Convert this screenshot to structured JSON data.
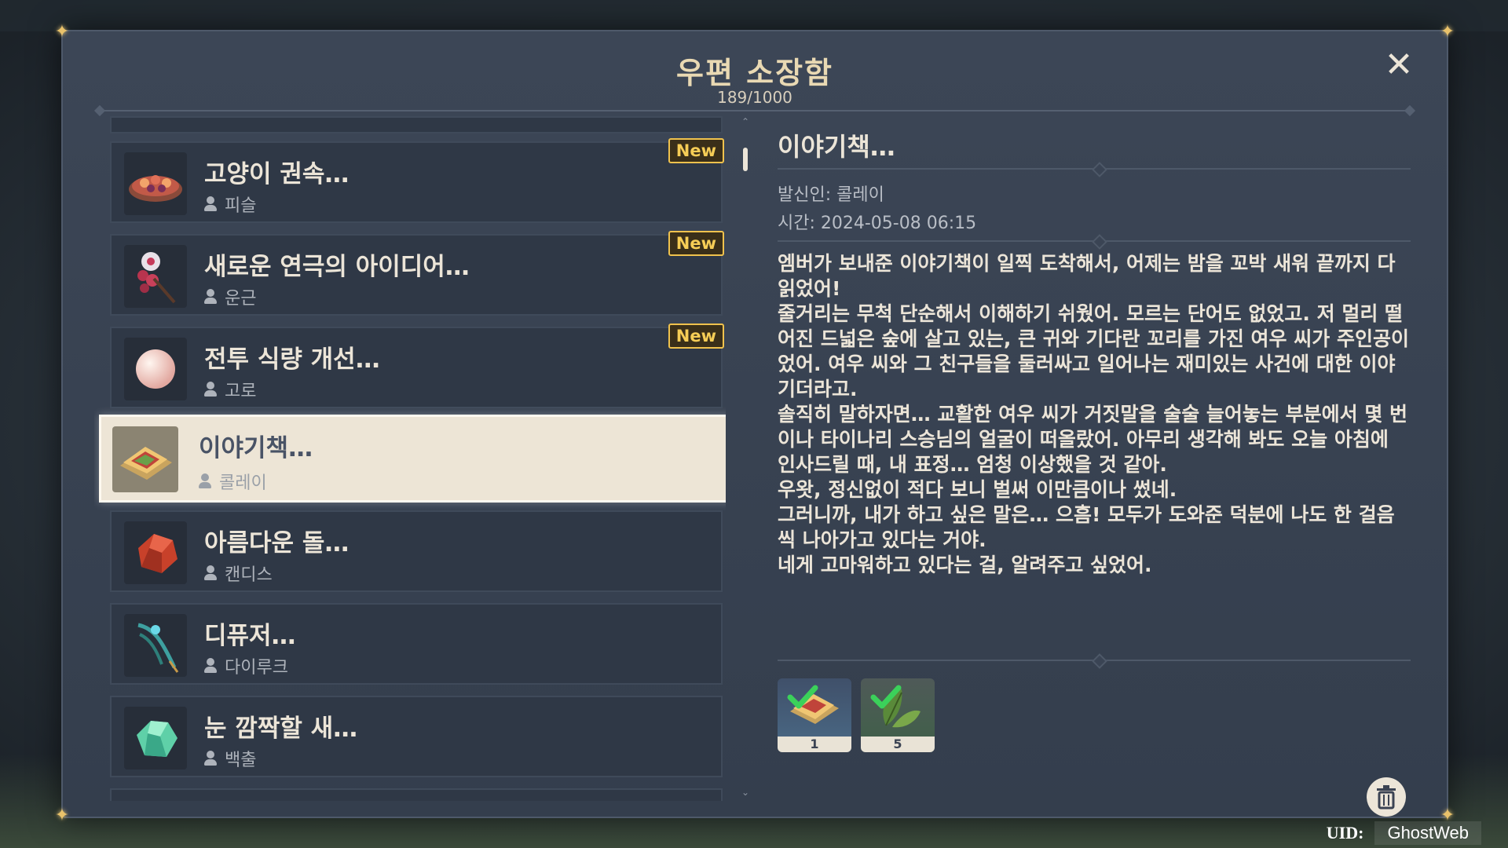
{
  "window": {
    "title": "우편 소장함",
    "count": "189/1000"
  },
  "mail_list": [
    {
      "title": "고양이 권속…",
      "sender": "피슬",
      "is_new": true,
      "new_label": "New",
      "icon": "meat-dish-icon"
    },
    {
      "title": "새로운 연극의 아이디어…",
      "sender": "운근",
      "is_new": true,
      "new_label": "New",
      "icon": "flower-pin-icon"
    },
    {
      "title": "전투 식량 개선…",
      "sender": "고로",
      "is_new": true,
      "new_label": "New",
      "icon": "pearl-icon"
    },
    {
      "title": "이야기책…",
      "sender": "콜레이",
      "is_new": false,
      "selected": true,
      "icon": "sandwich-icon"
    },
    {
      "title": "아름다운 돌…",
      "sender": "캔디스",
      "is_new": false,
      "icon": "red-crystal-icon"
    },
    {
      "title": "디퓨저…",
      "sender": "다이루크",
      "is_new": false,
      "icon": "feather-icon"
    },
    {
      "title": "눈 깜짝할 새…",
      "sender": "백출",
      "is_new": false,
      "icon": "green-crystal-icon"
    }
  ],
  "detail": {
    "title": "이야기책…",
    "sender": "발신인: 콜레이",
    "time": "시간: 2024-05-08 06:15",
    "body": [
      "엠버가 보내준 이야기책이 일찍 도착해서, 어제는 밤을 꼬박 새워 끝까지 다 읽었어!",
      "줄거리는 무척 단순해서 이해하기 쉬웠어. 모르는 단어도 없었고. 저 멀리 떨어진 드넓은 숲에 살고 있는, 큰 귀와 기다란 꼬리를 가진 여우 씨가 주인공이었어. 여우 씨와 그 친구들을 둘러싸고 일어나는 재미있는 사건에 대한 이야기더라고.",
      "솔직히 말하자면… 교활한 여우 씨가 거짓말을 술술 늘어놓는 부분에서 몇 번이나 타이나리 스승님의 얼굴이 떠올랐어. 아무리 생각해 봐도 오늘 아침에 인사드릴 때, 내 표정… 엄청 이상했을 것 같아.",
      "우왓, 정신없이 적다 보니 벌써 이만큼이나 썼네.",
      "그러니까, 내가 하고 싶은 말은… 으흠! 모두가 도와준 덕분에 나도 한 걸음씩 나아가고 있다는 거야.",
      "네게 고마워하고 있다는 걸, 알려주고 싶었어."
    ],
    "attachments": [
      {
        "icon": "sandwich-icon",
        "qty": "1",
        "claimed": true
      },
      {
        "icon": "herb-leaf-icon",
        "qty": "5",
        "claimed": true
      }
    ]
  },
  "uid": {
    "label": "UID:",
    "value": "GhostWeb"
  },
  "colors": {
    "accent": "#f0c24d",
    "panel": "#343e4d",
    "selected": "#ede5d6"
  }
}
